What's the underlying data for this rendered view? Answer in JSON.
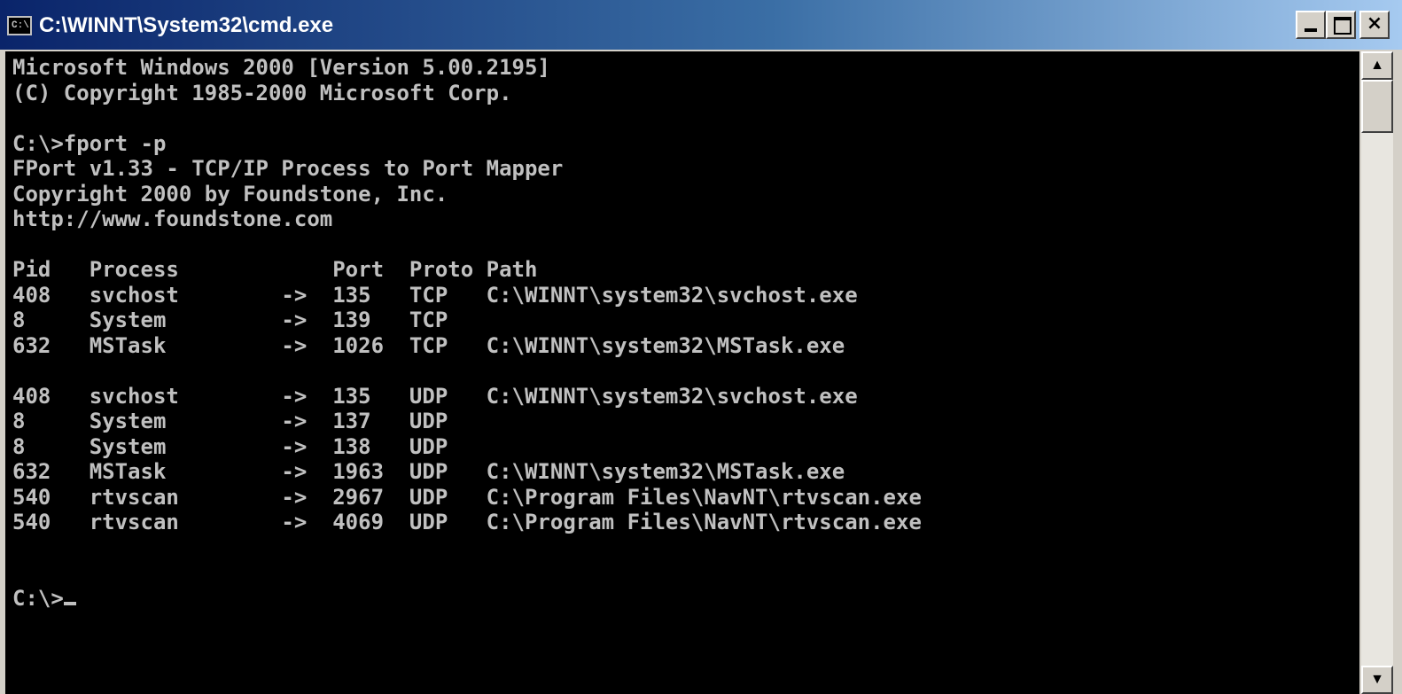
{
  "window": {
    "icon_text": "C:\\",
    "title": "C:\\WINNT\\System32\\cmd.exe",
    "minimize_label": "",
    "maximize_label": "",
    "close_label": "×"
  },
  "console": {
    "lines": [
      "Microsoft Windows 2000 [Version 5.00.2195]",
      "(C) Copyright 1985-2000 Microsoft Corp.",
      "",
      "C:\\>fport -p",
      "FPort v1.33 - TCP/IP Process to Port Mapper",
      "Copyright 2000 by Foundstone, Inc.",
      "http://www.foundstone.com",
      "",
      "Pid   Process            Port  Proto Path",
      "408   svchost        ->  135   TCP   C:\\WINNT\\system32\\svchost.exe",
      "8     System         ->  139   TCP",
      "632   MSTask         ->  1026  TCP   C:\\WINNT\\system32\\MSTask.exe",
      "",
      "408   svchost        ->  135   UDP   C:\\WINNT\\system32\\svchost.exe",
      "8     System         ->  137   UDP",
      "8     System         ->  138   UDP",
      "632   MSTask         ->  1963  UDP   C:\\WINNT\\system32\\MSTask.exe",
      "540   rtvscan        ->  2967  UDP   C:\\Program Files\\NavNT\\rtvscan.exe",
      "540   rtvscan        ->  4069  UDP   C:\\Program Files\\NavNT\\rtvscan.exe",
      "",
      "",
      "C:\\>"
    ]
  },
  "scrollbar": {
    "up_icon": "▲",
    "down_icon": "▼"
  },
  "colors": {
    "title_bar_start": "#0a246a",
    "title_bar_end": "#a6caf0",
    "console_bg": "#000000",
    "console_fg": "#c0c0c0"
  }
}
